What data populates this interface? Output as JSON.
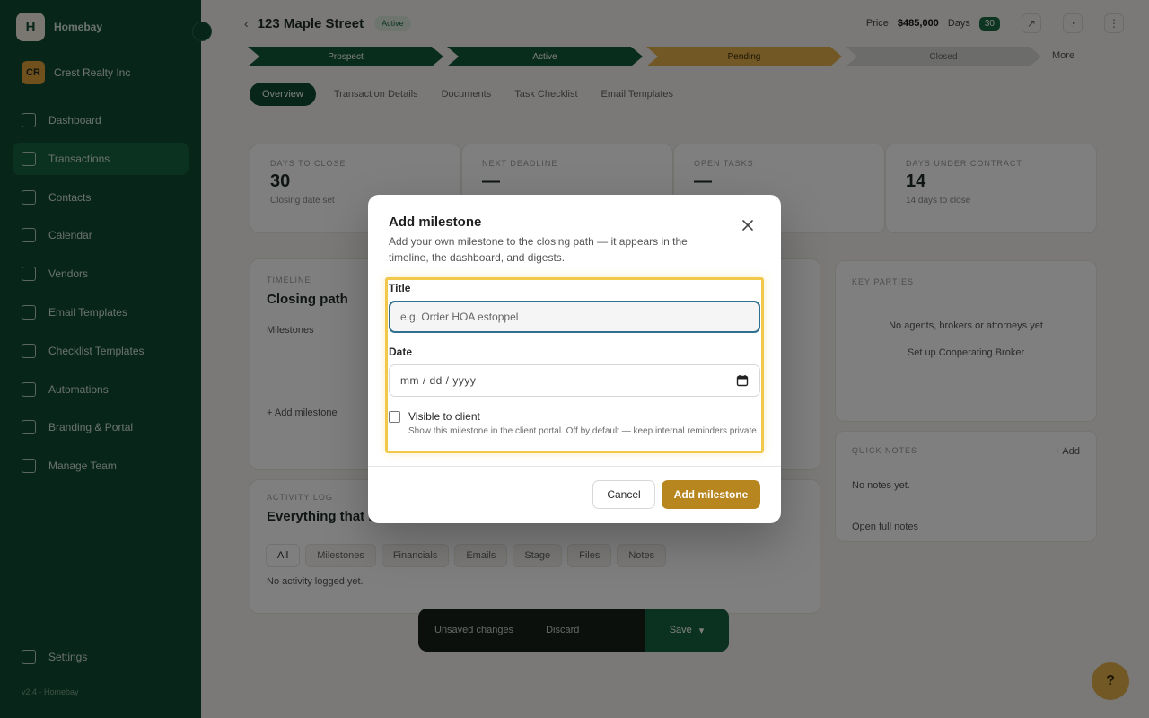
{
  "app": {
    "brand_name": "Homebay",
    "brand_initial": "H",
    "workspace_initials": "CR",
    "workspace_name": "Crest Realty Inc",
    "nav": [
      {
        "label": "Dashboard"
      },
      {
        "label": "Transactions"
      },
      {
        "label": "Contacts"
      },
      {
        "label": "Calendar"
      },
      {
        "label": "Vendors"
      },
      {
        "label": "Email Templates"
      },
      {
        "label": "Checklist Templates"
      },
      {
        "label": "Automations"
      },
      {
        "label": "Branding & Portal"
      },
      {
        "label": "Manage Team"
      }
    ],
    "settings_label": "Settings",
    "footer": "v2.4 · Homebay"
  },
  "header": {
    "back_icon": "chevron-left-icon",
    "title": "123 Maple Street",
    "status": "Active",
    "price_label": "Price",
    "price": "$485,000",
    "days_label": "Days",
    "days_value": "30"
  },
  "stages": [
    {
      "label": "Prospect"
    },
    {
      "label": "Active"
    },
    {
      "label": "Pending"
    },
    {
      "label": "Closed"
    }
  ],
  "more_label": "More",
  "tabs": [
    {
      "label": "Overview"
    },
    {
      "label": "Transaction Details"
    },
    {
      "label": "Documents"
    },
    {
      "label": "Task Checklist"
    },
    {
      "label": "Email Templates"
    }
  ],
  "stats": [
    {
      "label": "DAYS TO CLOSE",
      "value": "30",
      "sub": "Closing date set"
    },
    {
      "label": "NEXT DEADLINE",
      "value": "—",
      "sub": ""
    },
    {
      "label": "OPEN TASKS",
      "value": "—",
      "sub": ""
    },
    {
      "label": "DAYS UNDER CONTRACT",
      "value": "14",
      "sub": "14 days to close"
    }
  ],
  "closing_path": {
    "label": "TIMELINE",
    "title": "Closing path",
    "sub": "Milestones",
    "add_link": "+ Add milestone"
  },
  "activity": {
    "label": "ACTIVITY LOG",
    "title": "Everything that happened",
    "tabs": [
      {
        "label": "All"
      },
      {
        "label": "Milestones"
      },
      {
        "label": "Financials"
      },
      {
        "label": "Emails"
      },
      {
        "label": "Stage"
      },
      {
        "label": "Files"
      },
      {
        "label": "Notes"
      }
    ],
    "empty": "No activity logged yet."
  },
  "parties": {
    "label": "KEY PARTIES",
    "line1": "No agents, brokers or attorneys yet",
    "line2": "Set up Cooperating Broker"
  },
  "notes": {
    "label": "QUICK NOTES",
    "add": "+ Add",
    "empty": "No notes yet.",
    "link": "Open full notes"
  },
  "float_bar": {
    "unsaved": "Unsaved changes",
    "discard": "Discard",
    "save": "Save"
  },
  "help_label": "?",
  "modal": {
    "title": "Add milestone",
    "description": "Add your own milestone to the closing path — it appears in the timeline, the dashboard, and digests.",
    "close_icon": "close-icon",
    "title_label": "Title",
    "title_placeholder": "e.g. Order HOA estoppel",
    "title_value": "",
    "date_label": "Date",
    "date_value": "mm / dd / yyyy",
    "calendar_icon": "calendar-icon",
    "visible_label": "Visible to client",
    "visible_checked": false,
    "visible_help": "Show this milestone in the client portal. Off by default — keep internal reminders private.",
    "cancel_label": "Cancel",
    "submit_label": "Add milestone"
  },
  "colors": {
    "sidebar": "#0f4d33",
    "accent_gold": "#b8861f",
    "highlight": "#f2c84b",
    "focus_border": "#2f6f8f"
  }
}
